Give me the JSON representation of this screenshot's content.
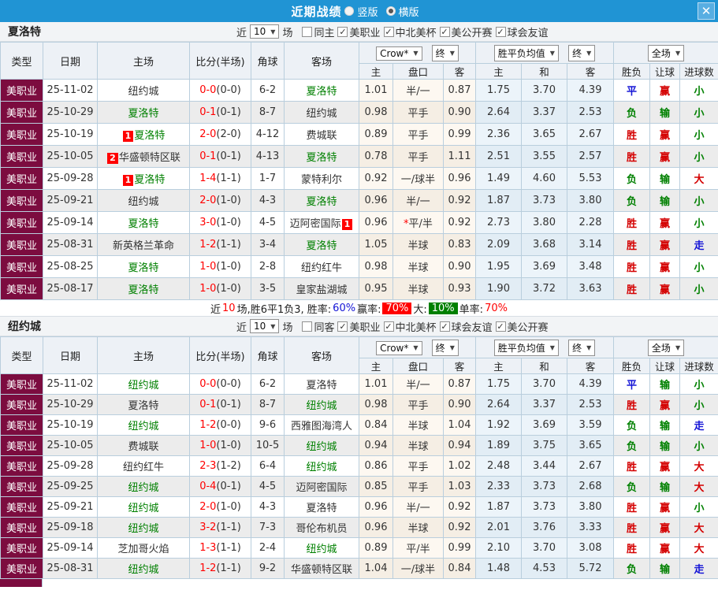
{
  "titlebar": {
    "title": "近期战绩",
    "close_icon": "✕",
    "radios": [
      {
        "label": "竖版",
        "selected": false
      },
      {
        "label": "横版",
        "selected": true
      }
    ]
  },
  "table_columns": {
    "type": "类型",
    "date": "日期",
    "home": "主场",
    "score": "比分(半场)",
    "corner": "角球",
    "away": "客场",
    "odds_sub": [
      "主",
      "盘口",
      "客"
    ],
    "avg_sub": [
      "主",
      "和",
      "客"
    ],
    "result_sub": [
      "胜负",
      "让球",
      "进球数"
    ],
    "selects": {
      "odds_company": "Crow*",
      "odds_time": "终",
      "avg_label": "胜平负均值",
      "avg_time": "终",
      "scope": "全场"
    },
    "dropdown_arrow": "▼"
  },
  "sections": [
    {
      "team": "夏洛特",
      "filter": {
        "prefix": "近",
        "count": "10",
        "suffix": "场",
        "same_label": "同主",
        "same_checked": false,
        "leagues": [
          {
            "label": "美职业",
            "checked": true
          },
          {
            "label": "中北美杯",
            "checked": true
          },
          {
            "label": "美公开赛",
            "checked": true
          },
          {
            "label": "球会友谊",
            "checked": true
          }
        ]
      },
      "rows": [
        {
          "type": "美职业",
          "date": "25-11-02",
          "home": "纽约城",
          "home_green": false,
          "home_badge": "",
          "score": "0-0",
          "half": "(0-0)",
          "corner": "6-2",
          "away": "夏洛特",
          "away_green": true,
          "away_badge": "",
          "odds": [
            "1.01",
            "半/一",
            "0.87"
          ],
          "avg": [
            "1.75",
            "3.70",
            "4.39"
          ],
          "res": [
            [
              "平",
              "blue"
            ],
            [
              "赢",
              "red"
            ],
            [
              "小",
              "green"
            ]
          ]
        },
        {
          "type": "美职业",
          "date": "25-10-29",
          "home": "夏洛特",
          "home_green": true,
          "home_badge": "",
          "score": "0-1",
          "half": "(0-1)",
          "corner": "8-7",
          "away": "纽约城",
          "away_green": false,
          "away_badge": "",
          "odds": [
            "0.98",
            "平手",
            "0.90"
          ],
          "avg": [
            "2.64",
            "3.37",
            "2.53"
          ],
          "res": [
            [
              "负",
              "green"
            ],
            [
              "输",
              "green"
            ],
            [
              "小",
              "green"
            ]
          ]
        },
        {
          "type": "美职业",
          "date": "25-10-19",
          "home": "夏洛特",
          "home_green": true,
          "home_badge": "1",
          "score": "2-0",
          "half": "(2-0)",
          "corner": "4-12",
          "away": "费城联",
          "away_green": false,
          "away_badge": "",
          "odds": [
            "0.89",
            "平手",
            "0.99"
          ],
          "avg": [
            "2.36",
            "3.65",
            "2.67"
          ],
          "res": [
            [
              "胜",
              "red"
            ],
            [
              "赢",
              "red"
            ],
            [
              "小",
              "green"
            ]
          ]
        },
        {
          "type": "美职业",
          "date": "25-10-05",
          "home": "华盛顿特区联",
          "home_green": false,
          "home_badge": "2",
          "score": "0-1",
          "half": "(0-1)",
          "corner": "4-13",
          "away": "夏洛特",
          "away_green": true,
          "away_badge": "",
          "odds": [
            "0.78",
            "平手",
            "1.11"
          ],
          "avg": [
            "2.51",
            "3.55",
            "2.57"
          ],
          "res": [
            [
              "胜",
              "red"
            ],
            [
              "赢",
              "red"
            ],
            [
              "小",
              "green"
            ]
          ]
        },
        {
          "type": "美职业",
          "date": "25-09-28",
          "home": "夏洛特",
          "home_green": true,
          "home_badge": "1",
          "score": "1-4",
          "half": "(1-1)",
          "corner": "1-7",
          "away": "蒙特利尔",
          "away_green": false,
          "away_badge": "",
          "odds": [
            "0.92",
            "一/球半",
            "0.96"
          ],
          "avg": [
            "1.49",
            "4.60",
            "5.53"
          ],
          "res": [
            [
              "负",
              "green"
            ],
            [
              "输",
              "green"
            ],
            [
              "大",
              "red"
            ]
          ]
        },
        {
          "type": "美职业",
          "date": "25-09-21",
          "home": "纽约城",
          "home_green": false,
          "home_badge": "",
          "score": "2-0",
          "half": "(1-0)",
          "corner": "4-3",
          "away": "夏洛特",
          "away_green": true,
          "away_badge": "",
          "odds": [
            "0.96",
            "半/一",
            "0.92"
          ],
          "avg": [
            "1.87",
            "3.73",
            "3.80"
          ],
          "res": [
            [
              "负",
              "green"
            ],
            [
              "输",
              "green"
            ],
            [
              "小",
              "green"
            ]
          ]
        },
        {
          "type": "美职业",
          "date": "25-09-14",
          "home": "夏洛特",
          "home_green": true,
          "home_badge": "",
          "score": "3-0",
          "half": "(1-0)",
          "corner": "4-5",
          "away": "迈阿密国际",
          "away_green": false,
          "away_badge": "1",
          "odds": [
            "0.96",
            "*平/半",
            "0.92"
          ],
          "avg": [
            "2.73",
            "3.80",
            "2.28"
          ],
          "res": [
            [
              "胜",
              "red"
            ],
            [
              "赢",
              "red"
            ],
            [
              "小",
              "green"
            ]
          ]
        },
        {
          "type": "美职业",
          "date": "25-08-31",
          "home": "新英格兰革命",
          "home_green": false,
          "home_badge": "",
          "score": "1-2",
          "half": "(1-1)",
          "corner": "3-4",
          "away": "夏洛特",
          "away_green": true,
          "away_badge": "",
          "odds": [
            "1.05",
            "半球",
            "0.83"
          ],
          "avg": [
            "2.09",
            "3.68",
            "3.14"
          ],
          "res": [
            [
              "胜",
              "red"
            ],
            [
              "赢",
              "red"
            ],
            [
              "走",
              "blue"
            ]
          ]
        },
        {
          "type": "美职业",
          "date": "25-08-25",
          "home": "夏洛特",
          "home_green": true,
          "home_badge": "",
          "score": "1-0",
          "half": "(1-0)",
          "corner": "2-8",
          "away": "纽约红牛",
          "away_green": false,
          "away_badge": "",
          "odds": [
            "0.98",
            "半球",
            "0.90"
          ],
          "avg": [
            "1.95",
            "3.69",
            "3.48"
          ],
          "res": [
            [
              "胜",
              "red"
            ],
            [
              "赢",
              "red"
            ],
            [
              "小",
              "green"
            ]
          ]
        },
        {
          "type": "美职业",
          "date": "25-08-17",
          "home": "夏洛特",
          "home_green": true,
          "home_badge": "",
          "score": "1-0",
          "half": "(1-0)",
          "corner": "3-5",
          "away": "皇家盐湖城",
          "away_green": false,
          "away_badge": "",
          "odds": [
            "0.95",
            "半球",
            "0.93"
          ],
          "avg": [
            "1.90",
            "3.72",
            "3.63"
          ],
          "res": [
            [
              "胜",
              "red"
            ],
            [
              "赢",
              "red"
            ],
            [
              "小",
              "green"
            ]
          ]
        }
      ],
      "summary": [
        {
          "text": "近",
          "style": "plain"
        },
        {
          "text": "10",
          "style": "red"
        },
        {
          "text": "场,胜6平1负3, 胜率:",
          "style": "plain"
        },
        {
          "text": "60%",
          "style": "blue"
        },
        {
          "text": " 赢率:",
          "style": "plain"
        },
        {
          "text": "70%",
          "style": "red-badge"
        },
        {
          "text": " 大:",
          "style": "plain"
        },
        {
          "text": "10%",
          "style": "green-badge"
        },
        {
          "text": " 单率:",
          "style": "plain"
        },
        {
          "text": "70%",
          "style": "red"
        }
      ],
      "partial_next_row": false
    },
    {
      "team": "纽约城",
      "filter": {
        "prefix": "近",
        "count": "10",
        "suffix": "场",
        "same_label": "同客",
        "same_checked": false,
        "leagues": [
          {
            "label": "美职业",
            "checked": true
          },
          {
            "label": "中北美杯",
            "checked": true
          },
          {
            "label": "球会友谊",
            "checked": true
          },
          {
            "label": "美公开赛",
            "checked": true
          }
        ]
      },
      "rows": [
        {
          "type": "美职业",
          "date": "25-11-02",
          "home": "纽约城",
          "home_green": true,
          "home_badge": "",
          "score": "0-0",
          "half": "(0-0)",
          "corner": "6-2",
          "away": "夏洛特",
          "away_green": false,
          "away_badge": "",
          "odds": [
            "1.01",
            "半/一",
            "0.87"
          ],
          "avg": [
            "1.75",
            "3.70",
            "4.39"
          ],
          "res": [
            [
              "平",
              "blue"
            ],
            [
              "输",
              "green"
            ],
            [
              "小",
              "green"
            ]
          ]
        },
        {
          "type": "美职业",
          "date": "25-10-29",
          "home": "夏洛特",
          "home_green": false,
          "home_badge": "",
          "score": "0-1",
          "half": "(0-1)",
          "corner": "8-7",
          "away": "纽约城",
          "away_green": true,
          "away_badge": "",
          "odds": [
            "0.98",
            "平手",
            "0.90"
          ],
          "avg": [
            "2.64",
            "3.37",
            "2.53"
          ],
          "res": [
            [
              "胜",
              "red"
            ],
            [
              "赢",
              "red"
            ],
            [
              "小",
              "green"
            ]
          ]
        },
        {
          "type": "美职业",
          "date": "25-10-19",
          "home": "纽约城",
          "home_green": true,
          "home_badge": "",
          "score": "1-2",
          "half": "(0-0)",
          "corner": "9-6",
          "away": "西雅图海湾人",
          "away_green": false,
          "away_badge": "",
          "odds": [
            "0.84",
            "半球",
            "1.04"
          ],
          "avg": [
            "1.92",
            "3.69",
            "3.59"
          ],
          "res": [
            [
              "负",
              "green"
            ],
            [
              "输",
              "green"
            ],
            [
              "走",
              "blue"
            ]
          ]
        },
        {
          "type": "美职业",
          "date": "25-10-05",
          "home": "费城联",
          "home_green": false,
          "home_badge": "",
          "score": "1-0",
          "half": "(1-0)",
          "corner": "10-5",
          "away": "纽约城",
          "away_green": true,
          "away_badge": "",
          "odds": [
            "0.94",
            "半球",
            "0.94"
          ],
          "avg": [
            "1.89",
            "3.75",
            "3.65"
          ],
          "res": [
            [
              "负",
              "green"
            ],
            [
              "输",
              "green"
            ],
            [
              "小",
              "green"
            ]
          ]
        },
        {
          "type": "美职业",
          "date": "25-09-28",
          "home": "纽约红牛",
          "home_green": false,
          "home_badge": "",
          "score": "2-3",
          "half": "(1-2)",
          "corner": "6-4",
          "away": "纽约城",
          "away_green": true,
          "away_badge": "",
          "odds": [
            "0.86",
            "平手",
            "1.02"
          ],
          "avg": [
            "2.48",
            "3.44",
            "2.67"
          ],
          "res": [
            [
              "胜",
              "red"
            ],
            [
              "赢",
              "red"
            ],
            [
              "大",
              "red"
            ]
          ]
        },
        {
          "type": "美职业",
          "date": "25-09-25",
          "home": "纽约城",
          "home_green": true,
          "home_badge": "",
          "score": "0-4",
          "half": "(0-1)",
          "corner": "4-5",
          "away": "迈阿密国际",
          "away_green": false,
          "away_badge": "",
          "odds": [
            "0.85",
            "平手",
            "1.03"
          ],
          "avg": [
            "2.33",
            "3.73",
            "2.68"
          ],
          "res": [
            [
              "负",
              "green"
            ],
            [
              "输",
              "green"
            ],
            [
              "大",
              "red"
            ]
          ]
        },
        {
          "type": "美职业",
          "date": "25-09-21",
          "home": "纽约城",
          "home_green": true,
          "home_badge": "",
          "score": "2-0",
          "half": "(1-0)",
          "corner": "4-3",
          "away": "夏洛特",
          "away_green": false,
          "away_badge": "",
          "odds": [
            "0.96",
            "半/一",
            "0.92"
          ],
          "avg": [
            "1.87",
            "3.73",
            "3.80"
          ],
          "res": [
            [
              "胜",
              "red"
            ],
            [
              "赢",
              "red"
            ],
            [
              "小",
              "green"
            ]
          ]
        },
        {
          "type": "美职业",
          "date": "25-09-18",
          "home": "纽约城",
          "home_green": true,
          "home_badge": "",
          "score": "3-2",
          "half": "(1-1)",
          "corner": "7-3",
          "away": "哥伦布机员",
          "away_green": false,
          "away_badge": "",
          "odds": [
            "0.96",
            "半球",
            "0.92"
          ],
          "avg": [
            "2.01",
            "3.76",
            "3.33"
          ],
          "res": [
            [
              "胜",
              "red"
            ],
            [
              "赢",
              "red"
            ],
            [
              "大",
              "red"
            ]
          ]
        },
        {
          "type": "美职业",
          "date": "25-09-14",
          "home": "芝加哥火焰",
          "home_green": false,
          "home_badge": "",
          "score": "1-3",
          "half": "(1-1)",
          "corner": "2-4",
          "away": "纽约城",
          "away_green": true,
          "away_badge": "",
          "odds": [
            "0.89",
            "平/半",
            "0.99"
          ],
          "avg": [
            "2.10",
            "3.70",
            "3.08"
          ],
          "res": [
            [
              "胜",
              "red"
            ],
            [
              "赢",
              "red"
            ],
            [
              "大",
              "red"
            ]
          ]
        },
        {
          "type": "美职业",
          "date": "25-08-31",
          "home": "纽约城",
          "home_green": true,
          "home_badge": "",
          "score": "1-2",
          "half": "(1-1)",
          "corner": "9-2",
          "away": "华盛顿特区联",
          "away_green": false,
          "away_badge": "",
          "odds": [
            "1.04",
            "一/球半",
            "0.84"
          ],
          "avg": [
            "1.48",
            "4.53",
            "5.72"
          ],
          "res": [
            [
              "负",
              "green"
            ],
            [
              "输",
              "green"
            ],
            [
              "走",
              "blue"
            ]
          ]
        }
      ],
      "summary": null,
      "partial_next_row": true
    }
  ],
  "glyphs": {
    "check_mark": "✓"
  }
}
